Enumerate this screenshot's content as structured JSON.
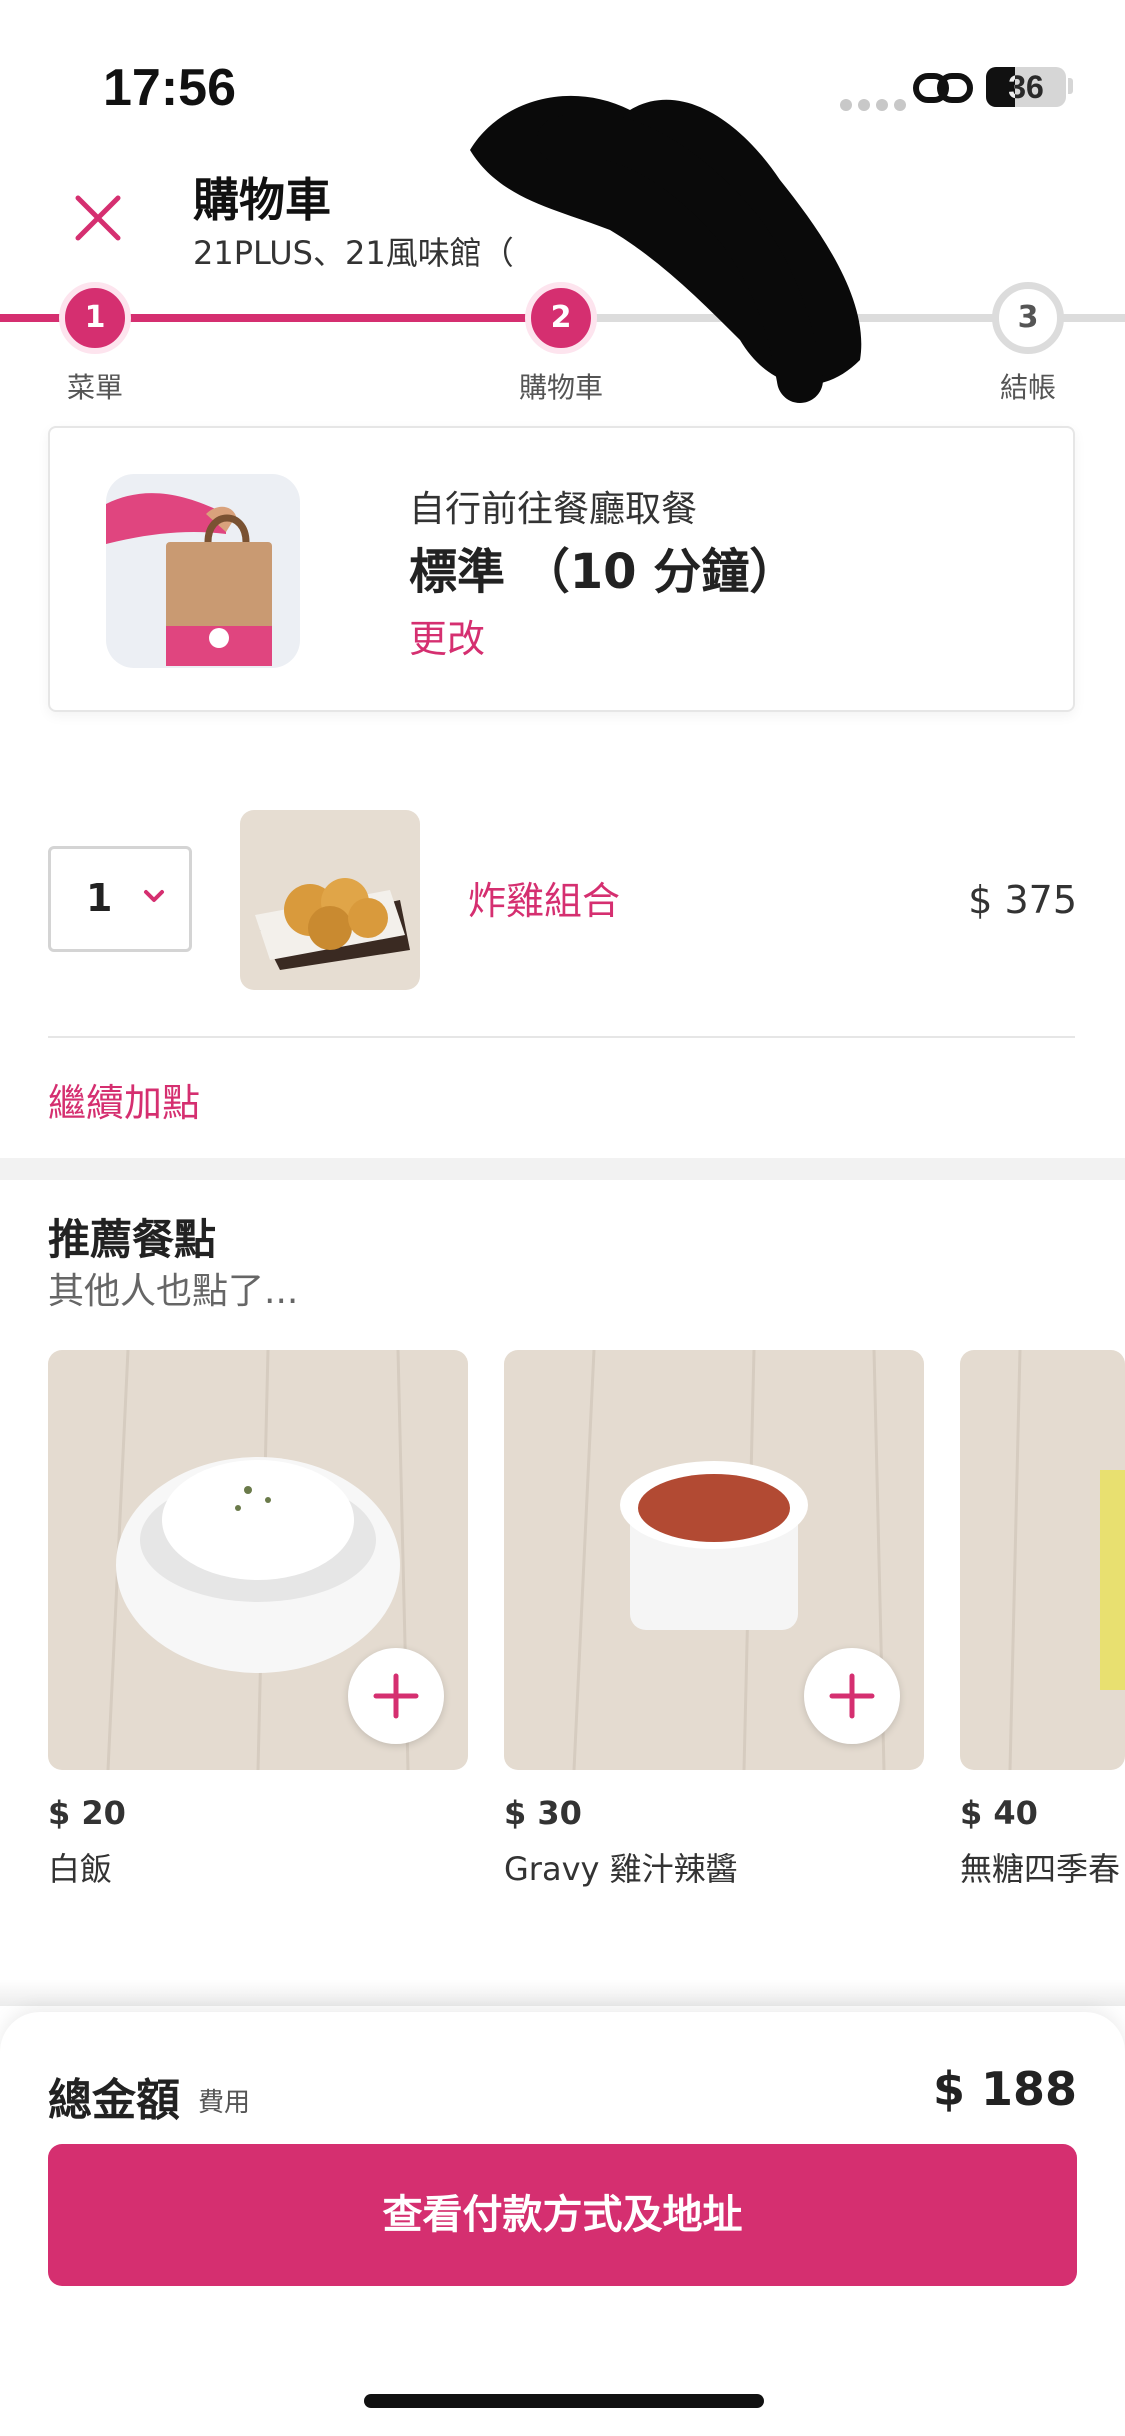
{
  "status_bar": {
    "time": "17:56",
    "battery": "36",
    "battery_level": 0.36
  },
  "header": {
    "title": "購物車",
    "subtitle": "21PLUS、21風味館（"
  },
  "progress": {
    "steps": [
      {
        "number": "1",
        "label": "菜單"
      },
      {
        "number": "2",
        "label": "購物車"
      },
      {
        "number": "3",
        "label": "結帳"
      }
    ]
  },
  "delivery": {
    "mode": "自行前往餐廳取餐",
    "time": "標準 （10 分鐘）",
    "change_label": "更改"
  },
  "cart": {
    "items": [
      {
        "quantity": "1",
        "name": "炸雞組合",
        "price": "$ 375"
      }
    ],
    "add_more_label": "繼續加點"
  },
  "recommendations": {
    "title": "推薦餐點",
    "subtitle": "其他人也點了...",
    "items": [
      {
        "price": "$ 20",
        "name": "白飯"
      },
      {
        "price": "$ 30",
        "name": "Gravy 雞汁辣醬"
      },
      {
        "price": "$ 40",
        "name": "無糖四季春"
      }
    ]
  },
  "summary": {
    "total_label": "總金額",
    "fee_label": "費用",
    "total_amount": "$ 188",
    "cta_label": "查看付款方式及地址"
  },
  "colors": {
    "brand": "#d52f70",
    "track_inactive": "#dcdcdc",
    "background": "#ffffff"
  },
  "icons": [
    "close-icon",
    "chevron-down-icon",
    "plus-icon",
    "link-icon",
    "battery-icon"
  ]
}
